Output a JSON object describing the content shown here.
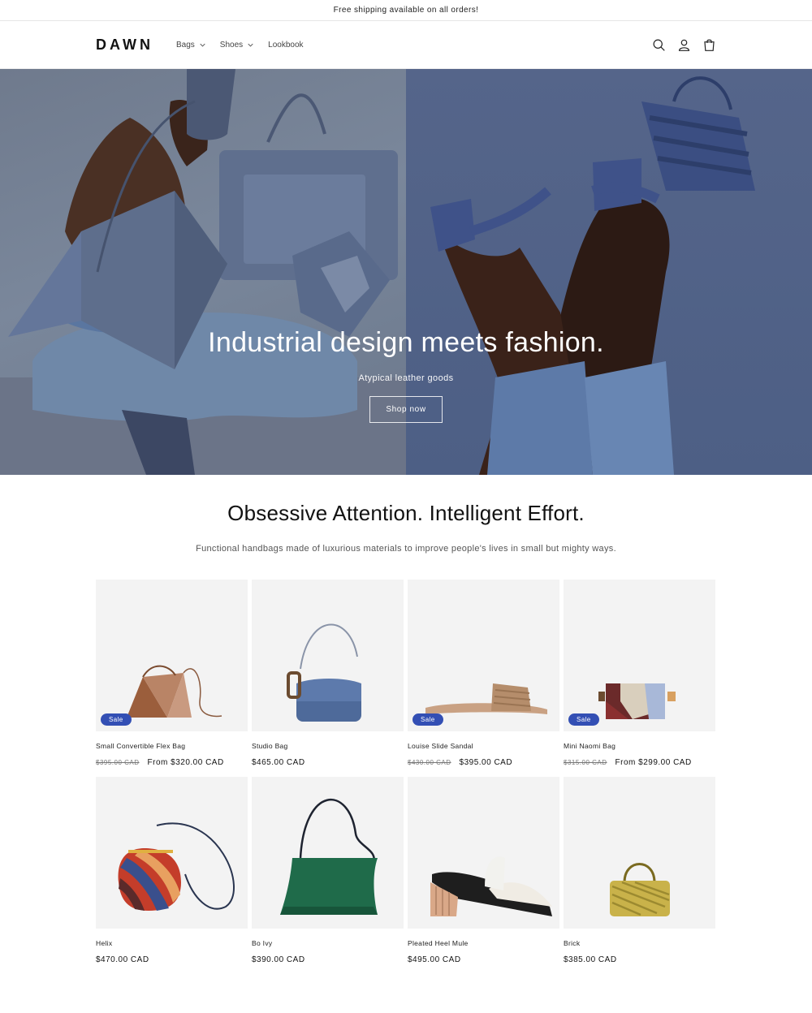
{
  "announcement": "Free shipping available on all orders!",
  "header": {
    "logo": "DAWN",
    "nav": [
      {
        "label": "Bags",
        "has_dropdown": true
      },
      {
        "label": "Shoes",
        "has_dropdown": true
      },
      {
        "label": "Lookbook",
        "has_dropdown": false
      }
    ],
    "icons": [
      "search-icon",
      "account-icon",
      "cart-icon"
    ]
  },
  "hero": {
    "title": "Industrial design meets fashion.",
    "subtitle": "Atypical leather goods",
    "button": "Shop now"
  },
  "intro": {
    "heading": "Obsessive Attention. Intelligent Effort.",
    "text": "Functional handbags made of luxurious materials to improve people's lives in small but mighty ways."
  },
  "products": [
    {
      "name": "Small Convertible Flex Bag",
      "sale": true,
      "badge": "Sale",
      "old_price": "$395.00 CAD",
      "price": "From $320.00 CAD"
    },
    {
      "name": "Studio Bag",
      "sale": false,
      "badge": "",
      "old_price": "",
      "price": "$465.00 CAD"
    },
    {
      "name": "Louise Slide Sandal",
      "sale": true,
      "badge": "Sale",
      "old_price": "$430.00 CAD",
      "price": "$395.00 CAD"
    },
    {
      "name": "Mini Naomi Bag",
      "sale": true,
      "badge": "Sale",
      "old_price": "$315.00 CAD",
      "price": "From $299.00 CAD"
    },
    {
      "name": "Helix",
      "sale": false,
      "badge": "",
      "old_price": "",
      "price": "$470.00 CAD"
    },
    {
      "name": "Bo Ivy",
      "sale": false,
      "badge": "",
      "old_price": "",
      "price": "$390.00 CAD"
    },
    {
      "name": "Pleated Heel Mule",
      "sale": false,
      "badge": "",
      "old_price": "",
      "price": "$495.00 CAD"
    },
    {
      "name": "Brick",
      "sale": false,
      "badge": "",
      "old_price": "",
      "price": "$385.00 CAD"
    }
  ],
  "colors": {
    "sale_badge": "#334fb4",
    "hero_left": "#77849a",
    "hero_right": "#51628a",
    "card_bg": "#f3f3f3"
  }
}
